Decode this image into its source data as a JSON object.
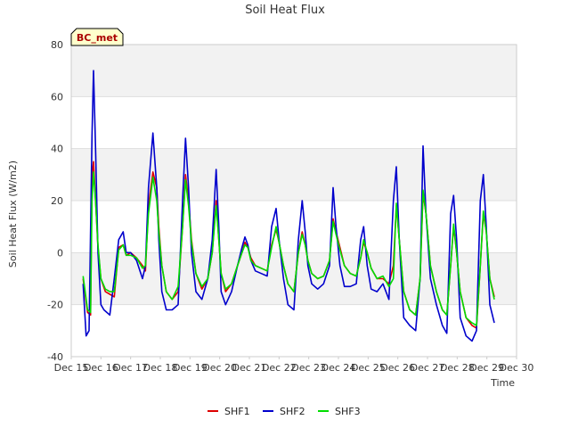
{
  "chart_data": {
    "type": "line",
    "title": "Soil Heat Flux",
    "xlabel": "Time",
    "ylabel": "Soil Heat Flux (W/m2)",
    "badge": "BC_met",
    "xlim": [
      15,
      30
    ],
    "ylim": [
      -40,
      80
    ],
    "x_ticks": [
      "Dec 15",
      "Dec 16",
      "Dec 17",
      "Dec 18",
      "Dec 19",
      "Dec 20",
      "Dec 21",
      "Dec 22",
      "Dec 23",
      "Dec 24",
      "Dec 25",
      "Dec 26",
      "Dec 27",
      "Dec 28",
      "Dec 29",
      "Dec 30"
    ],
    "y_ticks": [
      -40,
      -20,
      0,
      20,
      40,
      60,
      80
    ],
    "grid": true,
    "legend_position": "bottom-center",
    "series": [
      {
        "name": "SHF1",
        "color": "#dd0000",
        "x": [
          15.4,
          15.55,
          15.65,
          15.7,
          15.75,
          15.82,
          15.9,
          16.0,
          16.15,
          16.3,
          16.45,
          16.6,
          16.75,
          16.85,
          17.0,
          17.2,
          17.4,
          17.5,
          17.6,
          17.75,
          17.88,
          17.95,
          18.05,
          18.2,
          18.4,
          18.6,
          18.75,
          18.85,
          18.95,
          19.05,
          19.2,
          19.4,
          19.6,
          19.75,
          19.88,
          19.97,
          20.05,
          20.2,
          20.4,
          20.6,
          20.75,
          20.85,
          20.95,
          21.05,
          21.2,
          21.4,
          21.6,
          21.75,
          21.9,
          22.0,
          22.15,
          22.3,
          22.5,
          22.65,
          22.78,
          22.88,
          22.97,
          23.1,
          23.3,
          23.5,
          23.7,
          23.82,
          23.92,
          24.05,
          24.2,
          24.4,
          24.6,
          24.75,
          24.85,
          24.97,
          25.1,
          25.3,
          25.5,
          25.7,
          25.85,
          25.95,
          26.05,
          26.2,
          26.4,
          26.6,
          26.75,
          26.85,
          26.95,
          27.1,
          27.3,
          27.5,
          27.65,
          27.78,
          27.88,
          27.98,
          28.1,
          28.3,
          28.5,
          28.65,
          28.78,
          28.88,
          28.98,
          29.1,
          29.25
        ],
        "y": [
          -10,
          -23,
          -24,
          30,
          35,
          20,
          2,
          -10,
          -15,
          -16,
          -17,
          2,
          3,
          -1,
          0,
          -2,
          -5,
          -7,
          18,
          31,
          25,
          10,
          -5,
          -15,
          -18,
          -15,
          10,
          30,
          20,
          5,
          -8,
          -14,
          -10,
          0,
          20,
          5,
          -8,
          -15,
          -12,
          -5,
          0,
          4,
          2,
          -2,
          -5,
          -6,
          -7,
          3,
          9,
          4,
          -5,
          -12,
          -15,
          0,
          8,
          3,
          -3,
          -8,
          -10,
          -9,
          -3,
          13,
          8,
          2,
          -5,
          -8,
          -9,
          -2,
          4,
          0,
          -6,
          -10,
          -10,
          -12,
          -5,
          18,
          5,
          -15,
          -22,
          -24,
          -10,
          23,
          15,
          -5,
          -15,
          -22,
          -24,
          -5,
          10,
          0,
          -15,
          -25,
          -28,
          -29,
          -5,
          15,
          8,
          -10,
          -17
        ]
      },
      {
        "name": "SHF2",
        "color": "#0000cc",
        "x": [
          15.4,
          15.5,
          15.6,
          15.7,
          15.75,
          15.82,
          15.9,
          16.0,
          16.1,
          16.3,
          16.45,
          16.6,
          16.75,
          16.85,
          17.0,
          17.2,
          17.4,
          17.5,
          17.6,
          17.75,
          17.88,
          17.95,
          18.05,
          18.2,
          18.4,
          18.6,
          18.75,
          18.85,
          18.95,
          19.05,
          19.2,
          19.4,
          19.6,
          19.75,
          19.88,
          19.97,
          20.05,
          20.2,
          20.4,
          20.6,
          20.75,
          20.85,
          20.95,
          21.05,
          21.2,
          21.4,
          21.6,
          21.75,
          21.9,
          22.0,
          22.15,
          22.3,
          22.5,
          22.65,
          22.78,
          22.88,
          22.97,
          23.1,
          23.3,
          23.5,
          23.7,
          23.82,
          23.92,
          24.05,
          24.2,
          24.4,
          24.6,
          24.75,
          24.85,
          24.97,
          25.1,
          25.3,
          25.5,
          25.7,
          25.85,
          25.95,
          26.05,
          26.2,
          26.4,
          26.6,
          26.75,
          26.85,
          26.95,
          27.1,
          27.3,
          27.5,
          27.65,
          27.78,
          27.88,
          27.98,
          28.1,
          28.3,
          28.5,
          28.65,
          28.78,
          28.88,
          28.98,
          29.1,
          29.25
        ],
        "y": [
          -12,
          -32,
          -30,
          45,
          70,
          40,
          0,
          -20,
          -22,
          -24,
          -10,
          5,
          8,
          0,
          0,
          -3,
          -10,
          -5,
          25,
          46,
          25,
          5,
          -15,
          -22,
          -22,
          -20,
          20,
          44,
          25,
          0,
          -15,
          -18,
          -10,
          5,
          32,
          10,
          -15,
          -20,
          -15,
          -5,
          2,
          6,
          3,
          -3,
          -7,
          -8,
          -9,
          10,
          17,
          5,
          -10,
          -20,
          -22,
          5,
          20,
          8,
          -5,
          -12,
          -14,
          -12,
          -5,
          25,
          10,
          -5,
          -13,
          -13,
          -12,
          5,
          10,
          -5,
          -14,
          -15,
          -12,
          -18,
          20,
          33,
          5,
          -25,
          -28,
          -30,
          -10,
          41,
          15,
          -10,
          -20,
          -28,
          -31,
          15,
          22,
          5,
          -25,
          -32,
          -34,
          -30,
          20,
          30,
          10,
          -20,
          -27
        ]
      },
      {
        "name": "SHF3",
        "color": "#00dd00",
        "x": [
          15.4,
          15.55,
          15.65,
          15.7,
          15.75,
          15.82,
          15.9,
          16.0,
          16.15,
          16.3,
          16.45,
          16.6,
          16.75,
          16.85,
          17.0,
          17.2,
          17.4,
          17.5,
          17.6,
          17.75,
          17.88,
          17.95,
          18.05,
          18.2,
          18.4,
          18.6,
          18.75,
          18.85,
          18.95,
          19.05,
          19.2,
          19.4,
          19.6,
          19.75,
          19.88,
          19.97,
          20.05,
          20.2,
          20.4,
          20.6,
          20.75,
          20.85,
          20.95,
          21.05,
          21.2,
          21.4,
          21.6,
          21.75,
          21.9,
          22.0,
          22.15,
          22.3,
          22.5,
          22.65,
          22.78,
          22.88,
          22.97,
          23.1,
          23.3,
          23.5,
          23.7,
          23.82,
          23.92,
          24.05,
          24.2,
          24.4,
          24.6,
          24.75,
          24.85,
          24.97,
          25.1,
          25.3,
          25.5,
          25.7,
          25.85,
          25.95,
          26.05,
          26.2,
          26.4,
          26.6,
          26.75,
          26.85,
          26.95,
          27.1,
          27.3,
          27.5,
          27.65,
          27.78,
          27.88,
          27.98,
          28.1,
          28.3,
          28.5,
          28.65,
          28.78,
          28.88,
          28.98,
          29.1,
          29.25
        ],
        "y": [
          -9,
          -22,
          -23,
          20,
          31,
          20,
          3,
          -10,
          -14,
          -15,
          -15,
          1,
          3,
          -1,
          -1,
          -2,
          -6,
          -5,
          15,
          29,
          20,
          8,
          -5,
          -15,
          -18,
          -13,
          10,
          28,
          18,
          4,
          -8,
          -13,
          -10,
          0,
          18,
          5,
          -8,
          -14,
          -12,
          -5,
          0,
          3,
          2,
          -3,
          -5,
          -6,
          -7,
          2,
          10,
          4,
          -5,
          -12,
          -15,
          0,
          7,
          3,
          -3,
          -8,
          -10,
          -9,
          -3,
          12,
          7,
          1,
          -5,
          -8,
          -9,
          -2,
          5,
          0,
          -6,
          -10,
          -9,
          -13,
          -10,
          19,
          5,
          -15,
          -22,
          -24,
          -10,
          24,
          15,
          -5,
          -15,
          -22,
          -24,
          -5,
          11,
          0,
          -15,
          -25,
          -27,
          -28,
          -5,
          16,
          8,
          -10,
          -18
        ]
      }
    ]
  }
}
